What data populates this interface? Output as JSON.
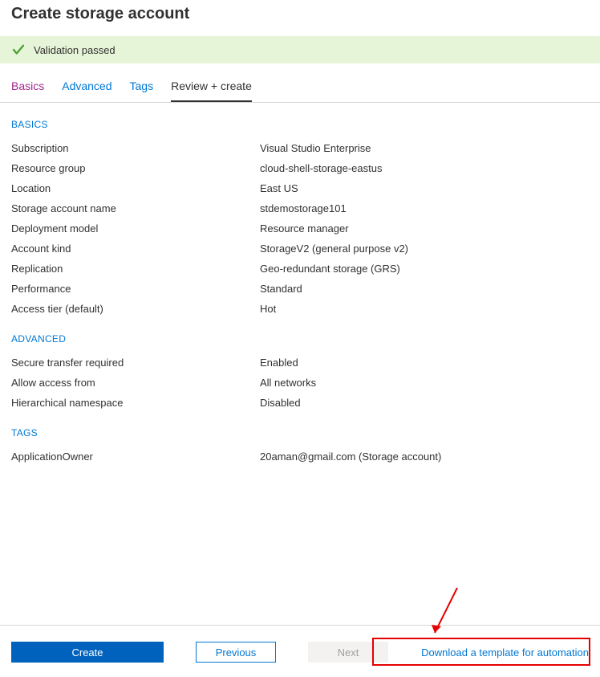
{
  "page_title": "Create storage account",
  "validation_text": "Validation passed",
  "tabs": [
    "Basics",
    "Advanced",
    "Tags",
    "Review + create"
  ],
  "sections": {
    "basics_head": "BASICS",
    "advanced_head": "ADVANCED",
    "tags_head": "TAGS"
  },
  "basics": [
    {
      "key": "Subscription",
      "val": "Visual Studio Enterprise"
    },
    {
      "key": "Resource group",
      "val": "cloud-shell-storage-eastus"
    },
    {
      "key": "Location",
      "val": "East US"
    },
    {
      "key": "Storage account name",
      "val": "stdemostorage101"
    },
    {
      "key": "Deployment model",
      "val": "Resource manager"
    },
    {
      "key": "Account kind",
      "val": "StorageV2 (general purpose v2)"
    },
    {
      "key": "Replication",
      "val": "Geo-redundant storage (GRS)"
    },
    {
      "key": "Performance",
      "val": "Standard"
    },
    {
      "key": "Access tier (default)",
      "val": "Hot"
    }
  ],
  "advanced": [
    {
      "key": "Secure transfer required",
      "val": "Enabled"
    },
    {
      "key": "Allow access from",
      "val": "All networks"
    },
    {
      "key": "Hierarchical namespace",
      "val": "Disabled"
    }
  ],
  "tags": [
    {
      "key": "ApplicationOwner",
      "val": "20aman@gmail.com (Storage account)"
    }
  ],
  "footer": {
    "create": "Create",
    "previous": "Previous",
    "next": "Next",
    "download_link": "Download a template for automation"
  }
}
